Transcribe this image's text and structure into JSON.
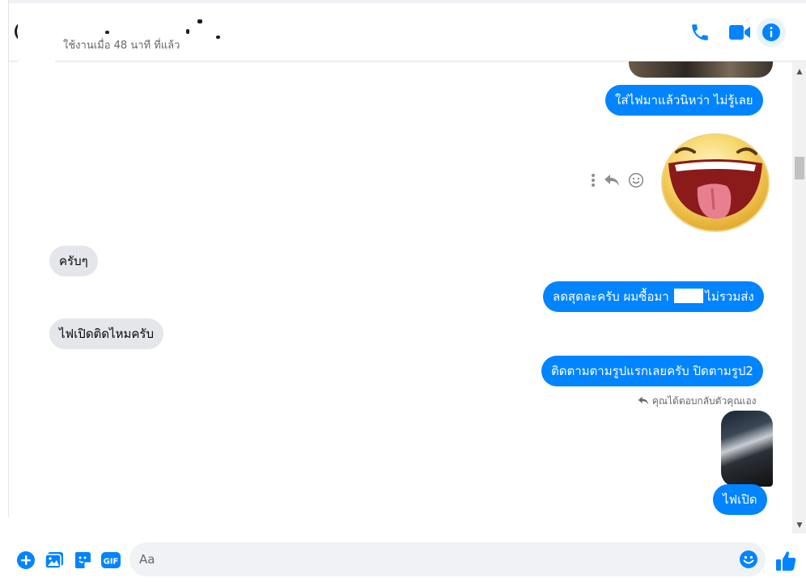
{
  "header": {
    "last_active": "ใช้งานเมื่อ 48 นาที ที่แล้ว",
    "icons": [
      "phone-icon",
      "video-camera-icon",
      "info-icon"
    ]
  },
  "messages": {
    "m1": "ใส่ไฟมาแล้วนิหว่า ไม่รู้เลย",
    "m2": "ครับๆ",
    "m3_a": "ลดสุดละครับ ผมซื้อมา",
    "m3_b": "ไม่รวมส่ง",
    "m4": "ไฟเปิดติดไหมครับ",
    "m5": "ติดตามตามรูปแรกเลยครับ ปิดตามรูป2",
    "reply_note": "คุณได้ตอบกลับตัวคุณเอง",
    "m6": "ไฟเปิด"
  },
  "sticker": {
    "icon": "laughing-tongue-sticker"
  },
  "message_actions": [
    "more-options-icon",
    "reply-icon",
    "react-emoji-icon"
  ],
  "composer": {
    "placeholder": "Aa",
    "icons": [
      "plus-icon",
      "photo-icon",
      "sticker-icon",
      "gif-icon",
      "emoji-icon",
      "like-icon"
    ]
  },
  "colors": {
    "accent": "#0084ff",
    "incoming_bubble": "#e4e6eb",
    "secondary_text": "#65676b"
  }
}
